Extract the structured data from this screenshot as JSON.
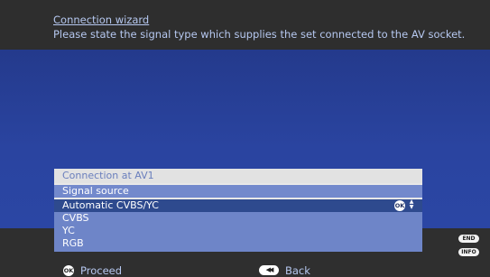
{
  "header": {
    "title": "Connection wizard",
    "subtitle": "Please state the signal type which supplies the set connected to the AV socket."
  },
  "panel": {
    "header": "Connection at AV1",
    "subheader": "Signal source",
    "items": [
      {
        "label": "Automatic CVBS/YC",
        "selected": true
      },
      {
        "label": "CVBS",
        "selected": false
      },
      {
        "label": "YC",
        "selected": false
      },
      {
        "label": "RGB",
        "selected": false
      }
    ],
    "ok_icon": "ok-button-icon",
    "updown_icon": "up-down-arrows-icon"
  },
  "side_buttons": {
    "end": "END",
    "info": "INFO"
  },
  "footer": {
    "ok_badge": "OK",
    "proceed": "Proceed",
    "back_badge": "◀◀",
    "back": "Back"
  },
  "colors": {
    "background_blue": "#2a44a0",
    "bar_dark": "#2e2e2e",
    "list_bg": "#6e85c8",
    "selected_row": "#2e4a8e",
    "text_light_blue": "#b6c8f0"
  }
}
